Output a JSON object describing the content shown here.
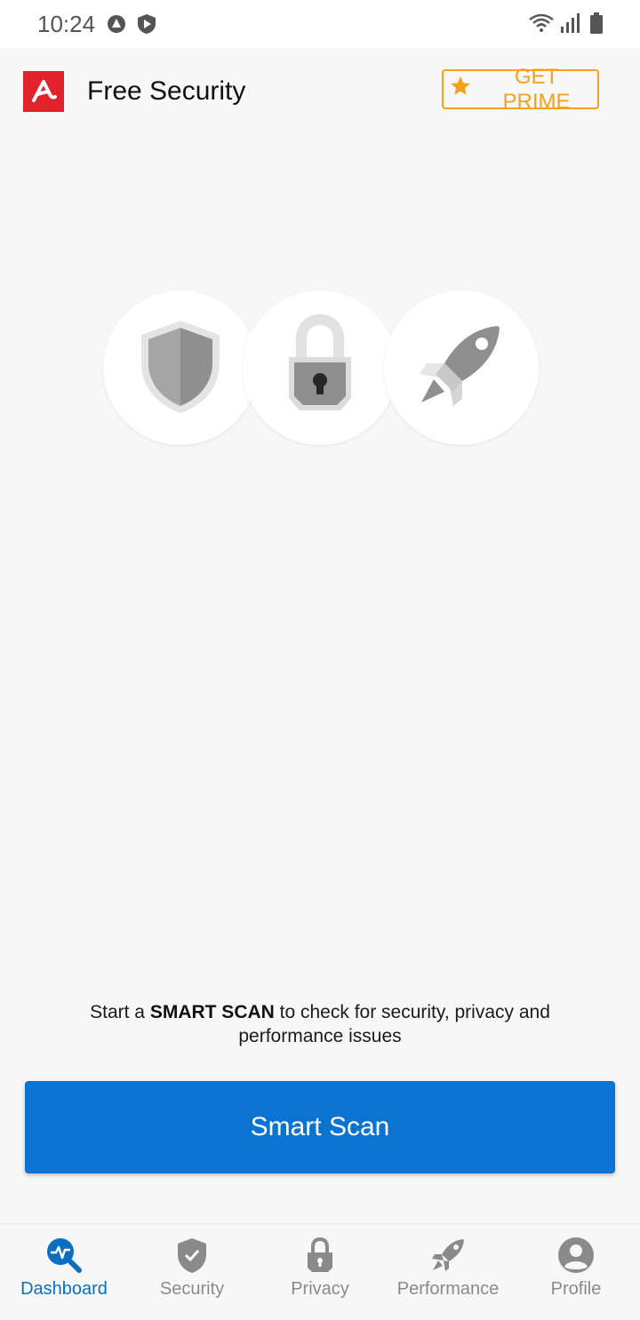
{
  "status_bar": {
    "time": "10:24",
    "icons": [
      "app-notification-icon",
      "shield-notification-icon",
      "wifi-icon",
      "signal-icon",
      "battery-icon"
    ]
  },
  "header": {
    "title": "Free Security",
    "logo_icon": "avira-logo-icon",
    "prime_button": {
      "label": "GET PRIME",
      "icon": "star-icon"
    }
  },
  "features": [
    {
      "icon": "shield-icon"
    },
    {
      "icon": "padlock-icon"
    },
    {
      "icon": "rocket-icon"
    }
  ],
  "scan": {
    "prompt_before": "Start a ",
    "prompt_bold": "SMART SCAN",
    "prompt_after": " to check for security, privacy and performance issues",
    "button_label": "Smart Scan"
  },
  "nav": {
    "items": [
      {
        "label": "Dashboard",
        "icon": "dashboard-icon",
        "active": true
      },
      {
        "label": "Security",
        "icon": "security-shield-icon",
        "active": false
      },
      {
        "label": "Privacy",
        "icon": "privacy-lock-icon",
        "active": false
      },
      {
        "label": "Performance",
        "icon": "performance-rocket-icon",
        "active": false
      },
      {
        "label": "Profile",
        "icon": "profile-icon",
        "active": false
      }
    ]
  },
  "colors": {
    "accent": "#0a74d0",
    "brand_red": "#e3232b",
    "prime_orange": "#f4a21b",
    "inactive_icon": "#8a8a8a"
  }
}
